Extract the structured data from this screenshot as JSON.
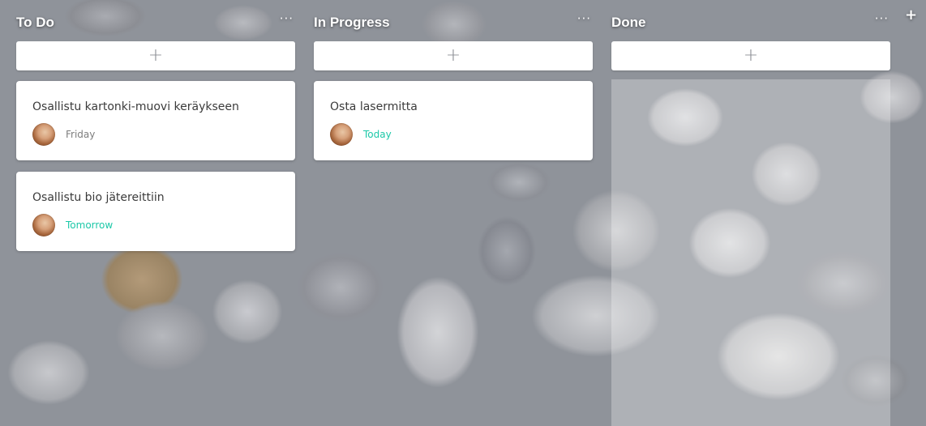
{
  "colors": {
    "accent_due": "#1cc8a8",
    "muted_due": "#7d7d7d",
    "card_bg": "#ffffff",
    "title_text": "#ffffff"
  },
  "add_column": {
    "icon": "plus-icon",
    "label": "+"
  },
  "columns": [
    {
      "title": "To Do",
      "more": "···",
      "add_label": "+",
      "cards": [
        {
          "title": "Osallistu kartonki-muovi keräykseen",
          "due": "Friday"
        },
        {
          "title": "Osallistu bio jätereittiin",
          "due": "Tomorrow"
        }
      ]
    },
    {
      "title": "In Progress",
      "more": "···",
      "add_label": "+",
      "cards": [
        {
          "title": "Osta lasermitta",
          "due": "Today"
        }
      ]
    },
    {
      "title": "Done",
      "more": "···",
      "add_label": "+",
      "cards": []
    }
  ]
}
